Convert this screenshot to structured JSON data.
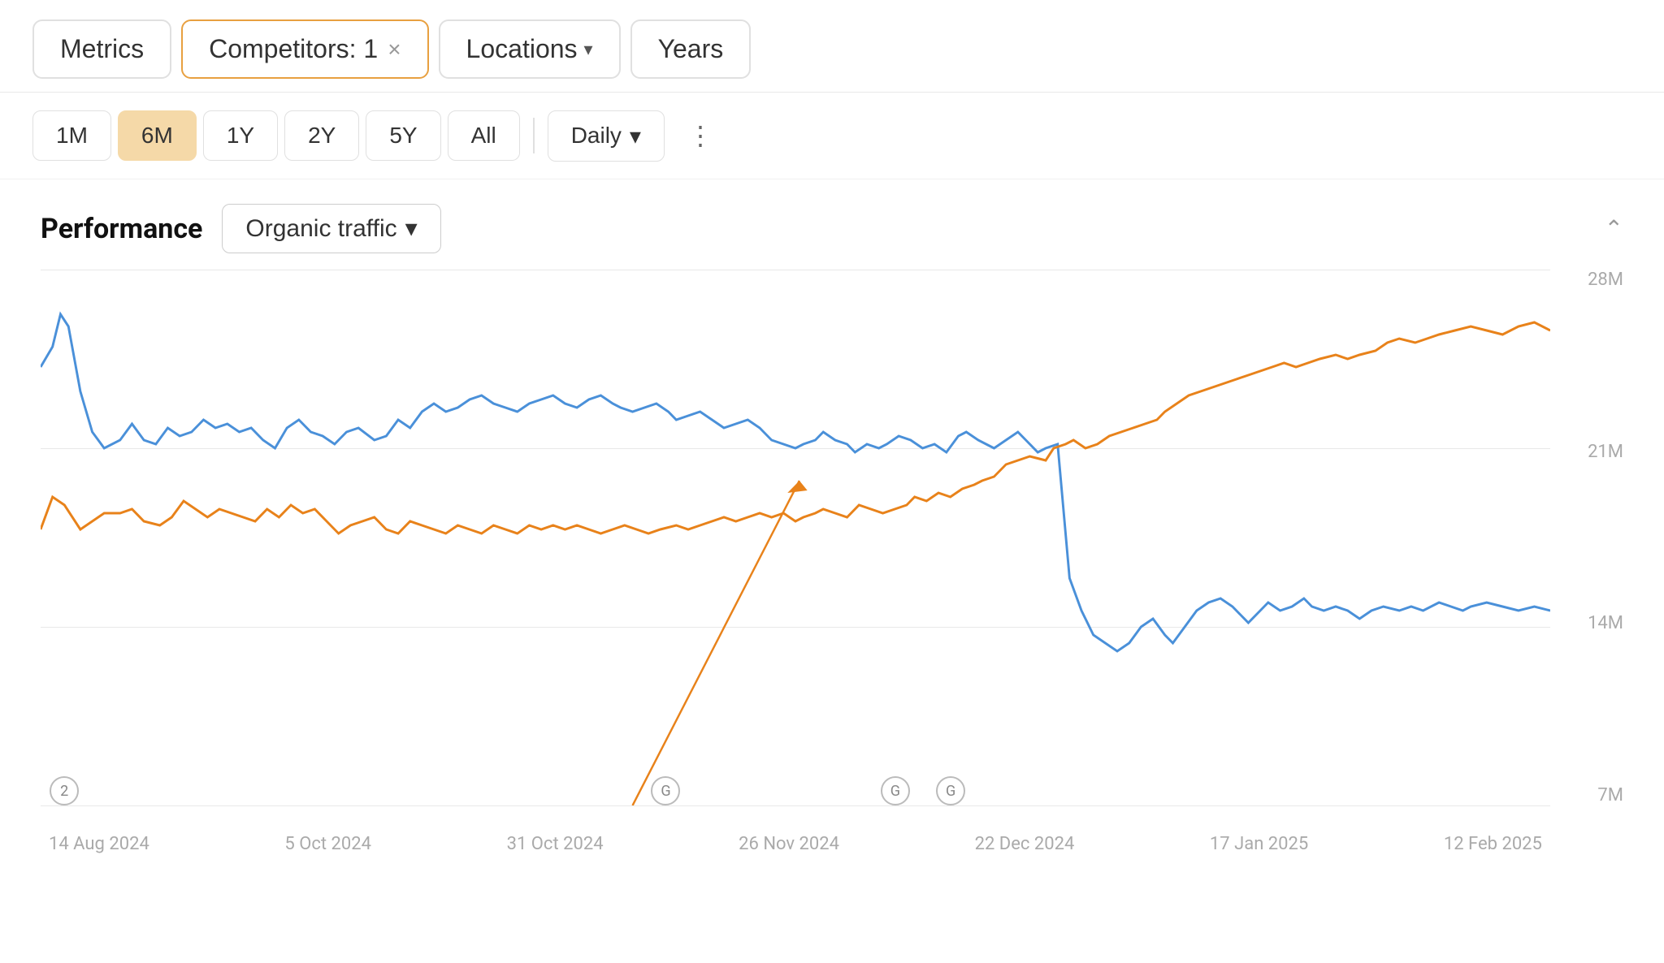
{
  "toolbar": {
    "metrics_label": "Metrics",
    "competitors_label": "Competitors: 1",
    "competitors_close": "×",
    "locations_label": "Locations",
    "years_label": "Years"
  },
  "time_filters": {
    "buttons": [
      "1M",
      "6M",
      "1Y",
      "2Y",
      "5Y",
      "All"
    ],
    "active": "6M",
    "granularity_label": "Daily",
    "dots": "⋮"
  },
  "chart": {
    "performance_label": "Performance",
    "metric_label": "Organic traffic",
    "collapse_icon": "chevron-up",
    "y_labels": [
      "28M",
      "21M",
      "14M",
      "7M"
    ],
    "x_labels": [
      "14 Aug 2024",
      "5 Oct 2024",
      "31 Oct 2024",
      "26 Nov 2024",
      "22 Dec 2024",
      "17 Jan 2025",
      "12 Feb 2025"
    ],
    "events": [
      {
        "label": "2",
        "x_pct": 1.5
      },
      {
        "label": "G",
        "x_pct": 39.5
      },
      {
        "label": "G",
        "x_pct": 54.0
      },
      {
        "label": "G",
        "x_pct": 57.5
      }
    ]
  },
  "colors": {
    "orange_accent": "#e8a040",
    "blue_line": "#4a90d9",
    "orange_line": "#e8821a",
    "active_bg": "#f5d9a8"
  }
}
